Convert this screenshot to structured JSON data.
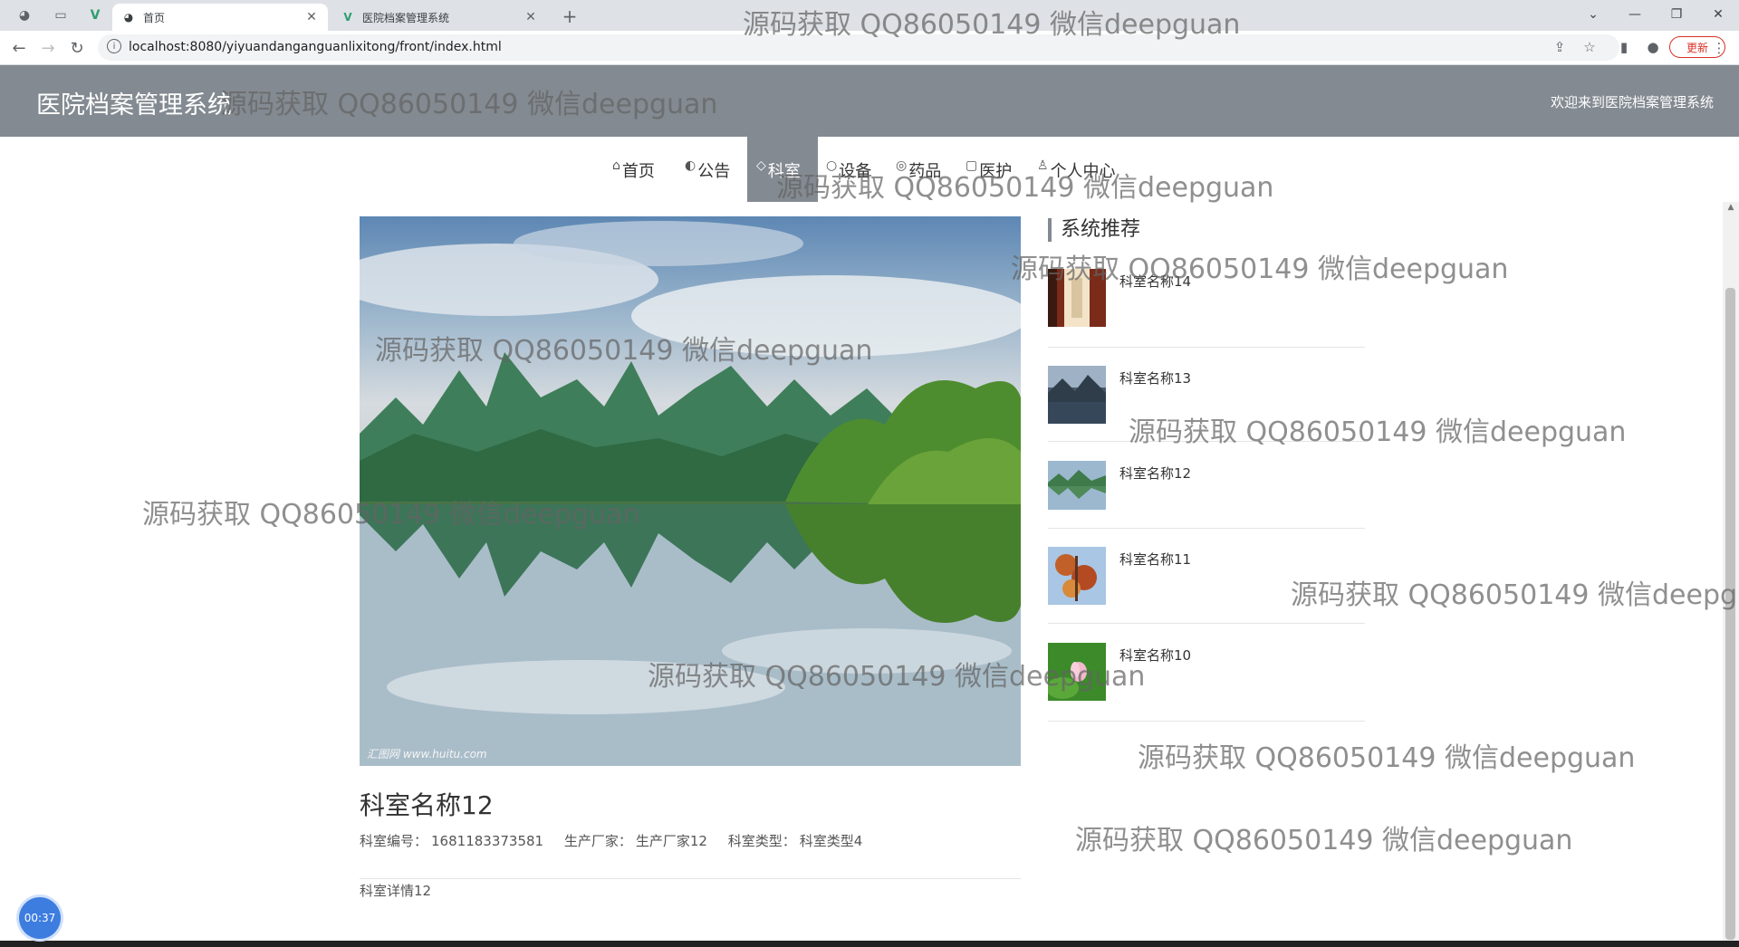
{
  "browser": {
    "tabs": [
      {
        "label": "首页",
        "active": true
      },
      {
        "label": "医院档案管理系统",
        "active": false
      }
    ],
    "url": "localhost:8080/yiyuandanganguanlixitong/front/index.html",
    "update_label": "更新"
  },
  "site": {
    "title": "医院档案管理系统",
    "welcome": "欢迎来到医院档案管理系统"
  },
  "menu": [
    {
      "label": "首页",
      "icon": "home-icon",
      "active": false
    },
    {
      "label": "公告",
      "icon": "palette-icon",
      "active": false
    },
    {
      "label": "科室",
      "icon": "tag-icon",
      "active": true
    },
    {
      "label": "设备",
      "icon": "circle-icon",
      "active": false
    },
    {
      "label": "药品",
      "icon": "pills-icon",
      "active": false
    },
    {
      "label": "医护",
      "icon": "calendar-icon",
      "active": false
    },
    {
      "label": "个人中心",
      "icon": "user-icon",
      "active": false
    }
  ],
  "detail": {
    "hero_credit": "汇图网 www.huitu.com",
    "title": "科室名称12",
    "meta": [
      {
        "label": "科室编号：",
        "value": "1681183373581"
      },
      {
        "label": "生产厂家：",
        "value": "生产厂家12"
      },
      {
        "label": "科室类型：",
        "value": "科室类型4"
      }
    ],
    "body": "科室详情12"
  },
  "recommend": {
    "title": "系统推荐",
    "items": [
      {
        "name": "科室名称14"
      },
      {
        "name": "科室名称13"
      },
      {
        "name": "科室名称12"
      },
      {
        "name": "科室名称11"
      },
      {
        "name": "科室名称10"
      }
    ]
  },
  "timer": "00:37",
  "watermark": "源码获取 QQ86050149 微信deepguan"
}
